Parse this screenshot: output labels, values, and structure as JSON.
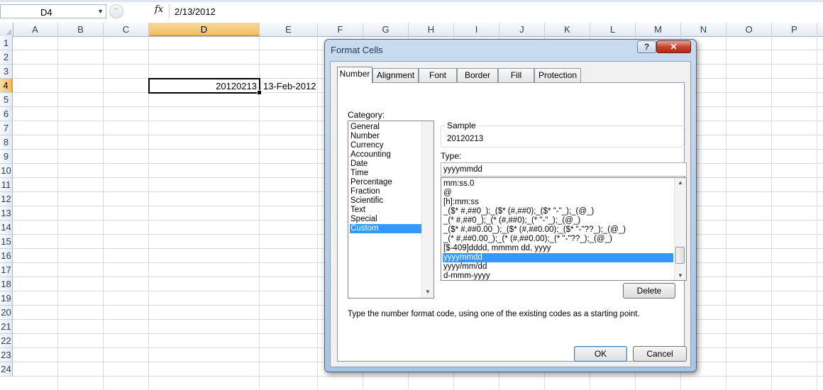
{
  "formula_bar": {
    "name_box": "D4",
    "fx_label": "fx",
    "formula": "2/13/2012"
  },
  "sheet": {
    "columns": [
      "A",
      "B",
      "C",
      "D",
      "E",
      "F",
      "G",
      "H",
      "I",
      "J",
      "K",
      "L",
      "M",
      "N",
      "O",
      "P"
    ],
    "rows": [
      "1",
      "2",
      "3",
      "4",
      "5",
      "6",
      "7",
      "8",
      "9",
      "10",
      "11",
      "12",
      "13",
      "14",
      "15",
      "16",
      "17",
      "18",
      "19",
      "20",
      "21",
      "22",
      "23",
      "24"
    ],
    "selected_column": "D",
    "selected_row": "4",
    "cells": {
      "D4": "20120213",
      "E4": "13-Feb-2012"
    }
  },
  "dialog": {
    "title": "Format Cells",
    "help_label": "?",
    "close_label": "✕",
    "tabs": [
      "Number",
      "Alignment",
      "Font",
      "Border",
      "Fill",
      "Protection"
    ],
    "active_tab": "Number",
    "category_label": "Category:",
    "categories": [
      "General",
      "Number",
      "Currency",
      "Accounting",
      "Date",
      "Time",
      "Percentage",
      "Fraction",
      "Scientific",
      "Text",
      "Special",
      "Custom"
    ],
    "selected_category": "Custom",
    "sample_label": "Sample",
    "sample_value": "20120213",
    "type_label": "Type:",
    "type_value": "yyyymmdd",
    "formats": [
      "mm:ss.0",
      "@",
      "[h]:mm:ss",
      "_($* #,##0_);_($* (#,##0);_($* \"-\"_);_(@_)",
      "_(* #,##0_);_(* (#,##0);_(* \"-\"_);_(@_)",
      "_($* #,##0.00_);_($* (#,##0.00);_($* \"-\"??_);_(@_)",
      "_(* #,##0.00_);_(* (#,##0.00);_(* \"-\"??_);_(@_)",
      "[$-409]dddd, mmmm dd, yyyy",
      "yyyymmdd",
      "yyyy/mm/dd",
      "d-mmm-yyyy"
    ],
    "selected_format": "yyyymmdd",
    "delete_label": "Delete",
    "hint": "Type the number format code, using one of the existing codes as a starting point.",
    "ok_label": "OK",
    "cancel_label": "Cancel"
  },
  "colors": {
    "selection": "#3399ff",
    "header_selected": "#f1c15f",
    "dialog_frame": "#b9cfe9",
    "close_button": "#c8452d"
  }
}
